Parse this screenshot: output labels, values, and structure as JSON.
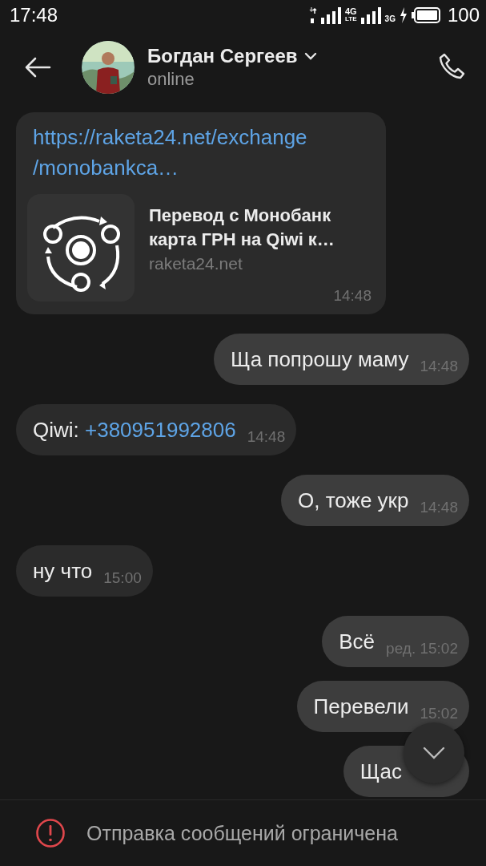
{
  "status_bar": {
    "time": "17:48",
    "network_1": "4G",
    "network_1_sub": "LTE",
    "network_2": "3G",
    "battery": "100"
  },
  "header": {
    "name": "Богдан Сергеев",
    "status": "online"
  },
  "messages": [
    {
      "kind": "link_preview",
      "outgoing": false,
      "url_lines": [
        "https://raketa24.net/exchange",
        "/monobankca…"
      ],
      "preview_title": "Перевод с Монобанк карта ГРН на Qiwi к…",
      "preview_site": "raketa24.net",
      "time": "14:48"
    },
    {
      "kind": "text",
      "outgoing": true,
      "text": "Ща попрошу маму",
      "time": "14:48"
    },
    {
      "kind": "text",
      "outgoing": false,
      "text": "Qiwi:",
      "link": "+380951992806",
      "time": "14:48"
    },
    {
      "kind": "text",
      "outgoing": true,
      "text": "О, тоже укр",
      "time": "14:48"
    },
    {
      "kind": "text",
      "outgoing": false,
      "text": "ну что",
      "time": "15:00"
    },
    {
      "kind": "text",
      "outgoing": true,
      "text": "Всё",
      "edited": "ред.",
      "time": "15:02"
    },
    {
      "kind": "text",
      "outgoing": true,
      "text": "Перевели",
      "time": "15:02"
    },
    {
      "kind": "text",
      "outgoing": true,
      "text": "Щас"
    }
  ],
  "footer": {
    "notice": "Отправка сообщений ограничена"
  }
}
